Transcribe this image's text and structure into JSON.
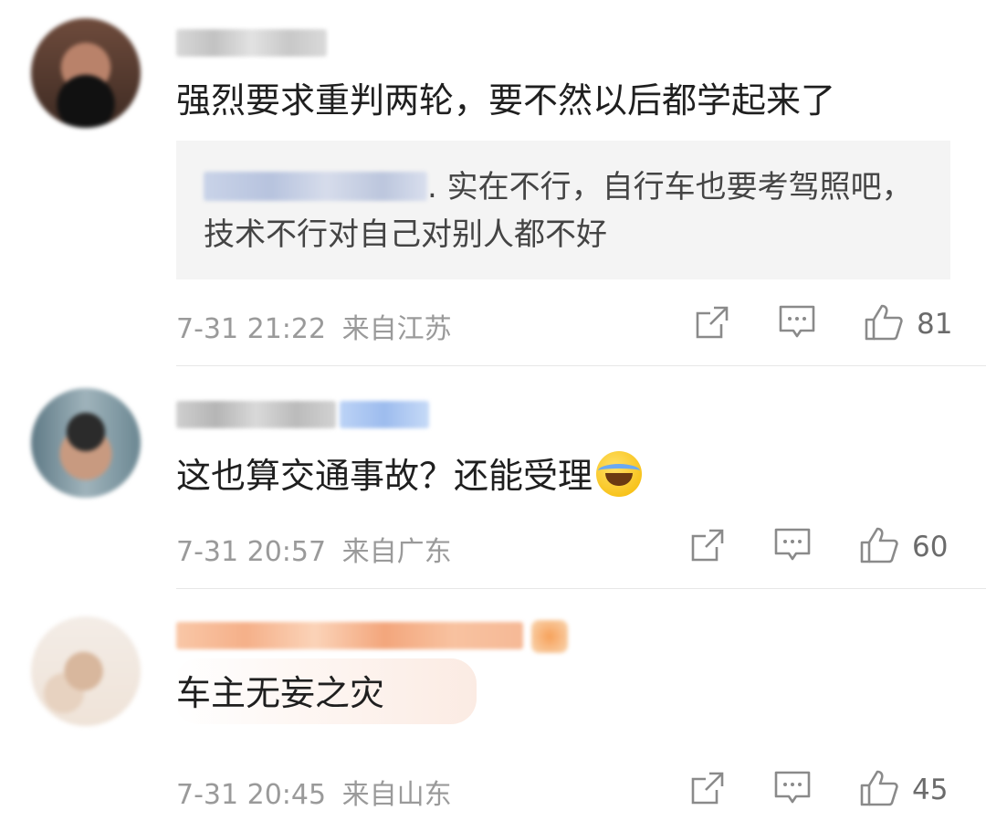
{
  "comments": [
    {
      "text": "强烈要求重判两轮，要不然以后都学起来了",
      "quote": {
        "separator": ". ",
        "text": "实在不行，自行车也要考驾照吧，技术不行对自己对别人都不好"
      },
      "time": "7-31 21:22",
      "location": "来自江苏",
      "likes": "81"
    },
    {
      "text": "这也算交通事故？还能受理",
      "emoji": "laughing-tears-emoji",
      "time": "7-31 20:57",
      "location": "来自广东",
      "likes": "60"
    },
    {
      "text": "车主无妄之灾",
      "time": "7-31 20:45",
      "location": "来自山东",
      "likes": "45"
    }
  ],
  "icons": {
    "share": "share-icon",
    "reply": "comment-icon",
    "like": "thumbs-up-icon"
  }
}
